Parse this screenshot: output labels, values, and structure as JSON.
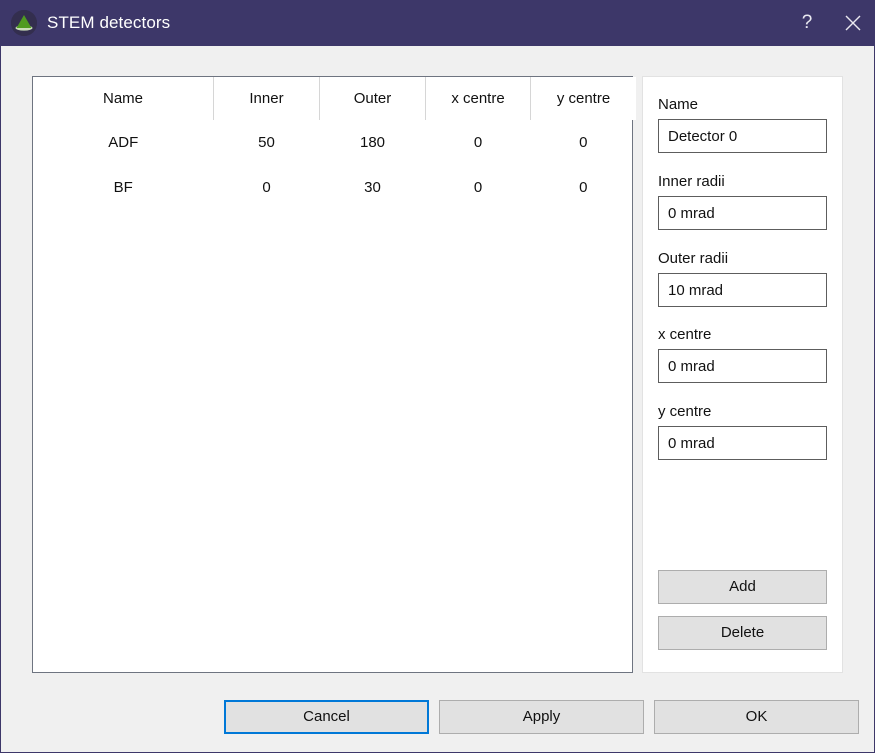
{
  "window": {
    "title": "STEM detectors",
    "icon": "cone-icon",
    "titlebar_color": "#3d3769",
    "accent_color": "#0078d7",
    "help_label": "?",
    "close_label": "✕"
  },
  "table": {
    "columns": [
      "Name",
      "Inner",
      "Outer",
      "x centre",
      "y centre"
    ],
    "rows": [
      {
        "name": "ADF",
        "inner": "50",
        "outer": "180",
        "x_centre": "0",
        "y_centre": "0"
      },
      {
        "name": "BF",
        "inner": "0",
        "outer": "30",
        "x_centre": "0",
        "y_centre": "0"
      }
    ]
  },
  "editor": {
    "fields": [
      {
        "label": "Name",
        "value": "Detector 0"
      },
      {
        "label": "Inner radii",
        "value": "0 mrad"
      },
      {
        "label": "Outer radii",
        "value": "10 mrad"
      },
      {
        "label": "x centre",
        "value": "0 mrad"
      },
      {
        "label": "y centre",
        "value": "0 mrad"
      }
    ],
    "add_label": "Add",
    "delete_label": "Delete"
  },
  "footer": {
    "cancel_label": "Cancel",
    "apply_label": "Apply",
    "ok_label": "OK"
  }
}
